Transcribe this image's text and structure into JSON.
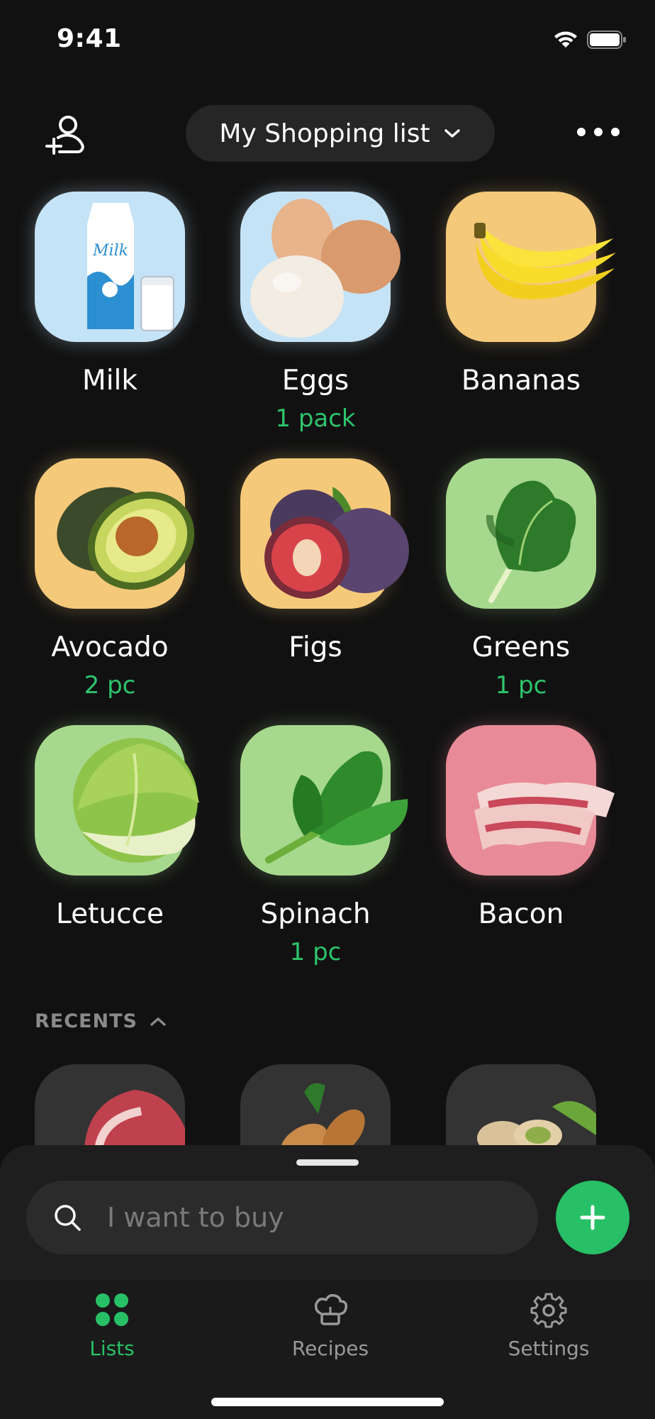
{
  "status_bar": {
    "time": "9:41"
  },
  "header": {
    "list_title": "My Shopping list"
  },
  "items": [
    {
      "name": "Milk",
      "qty": "",
      "bg": "#c5e3f7",
      "icon": "milk-carton"
    },
    {
      "name": "Eggs",
      "qty": "1 pack",
      "bg": "#c5e3f7",
      "icon": "eggs"
    },
    {
      "name": "Bananas",
      "qty": "",
      "bg": "#f5c97a",
      "icon": "bananas"
    },
    {
      "name": "Avocado",
      "qty": "2 pc",
      "bg": "#f5c97a",
      "icon": "avocado"
    },
    {
      "name": "Figs",
      "qty": "",
      "bg": "#f5c97a",
      "icon": "figs"
    },
    {
      "name": "Greens",
      "qty": "1 pc",
      "bg": "#a6d98d",
      "icon": "greens"
    },
    {
      "name": "Letucce",
      "qty": "",
      "bg": "#a6d98d",
      "icon": "lettuce"
    },
    {
      "name": "Spinach",
      "qty": "1 pc",
      "bg": "#a6d98d",
      "icon": "spinach"
    },
    {
      "name": "Bacon",
      "qty": "",
      "bg": "#e88a97",
      "icon": "bacon"
    }
  ],
  "recents": {
    "label": "RECENTS"
  },
  "search": {
    "placeholder": "I want to buy"
  },
  "tabs": [
    {
      "label": "Lists",
      "active": true
    },
    {
      "label": "Recipes",
      "active": false
    },
    {
      "label": "Settings",
      "active": false
    }
  ],
  "colors": {
    "accent": "#27c066",
    "qty_text": "#2ec46c",
    "inactive": "#9a9a9a"
  }
}
